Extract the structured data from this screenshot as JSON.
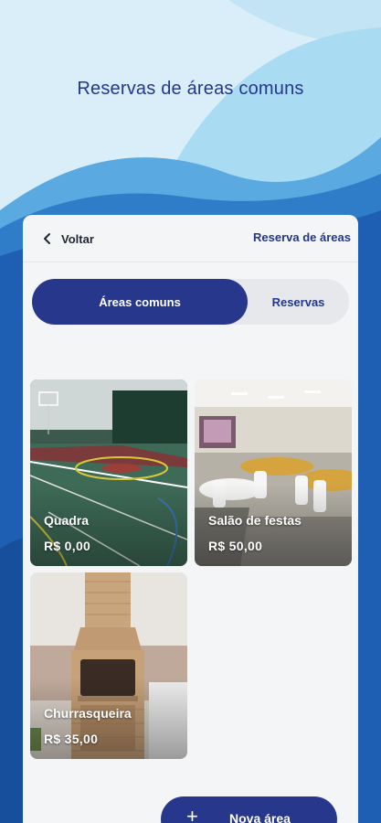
{
  "header": {
    "title": "Reservas de áreas comuns"
  },
  "topbar": {
    "back_label": "Voltar",
    "section_title": "Reserva de áreas"
  },
  "tabs": [
    {
      "label": "Áreas comuns",
      "active": true
    },
    {
      "label": "Reservas",
      "active": false
    }
  ],
  "areas": [
    {
      "name": "Quadra",
      "price": "R$ 0,00",
      "image": "sports-court"
    },
    {
      "name": "Salão de festas",
      "price": "R$ 50,00",
      "image": "party-hall"
    },
    {
      "name": "Churrasqueira",
      "price": "R$ 35,00",
      "image": "brick-barbecue"
    }
  ],
  "fab": {
    "icon": "plus-icon",
    "label": "Nova área"
  },
  "colors": {
    "primary": "#27388c",
    "title_text": "#24378a",
    "card_bg": "#f4f5f7",
    "sky_light": "#d6edf8",
    "wave_blue": "#1e5fb4"
  }
}
